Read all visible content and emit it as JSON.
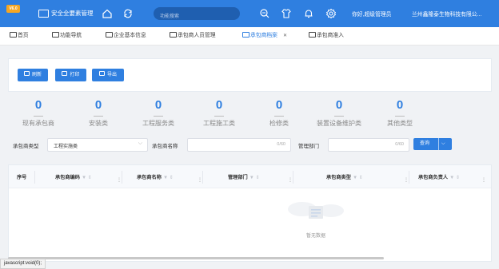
{
  "header": {
    "logo_text": "V6.0",
    "system_title": "安全全要素管理",
    "search_placeholder": "功能搜索",
    "greeting": "你好,超级管理员",
    "company": "兰州鑫隆泰生物科技有限公...",
    "icons": [
      "monitor-icon",
      "home-icon",
      "refresh-icon",
      "zoom-icon",
      "shirt-icon",
      "bell-icon",
      "gear-icon"
    ],
    "bar_color": "#2f7fe0"
  },
  "tabs": [
    {
      "label": "首页"
    },
    {
      "label": "功能导航"
    },
    {
      "label": "企业基本信息"
    },
    {
      "label": "承包商人员管理"
    },
    {
      "label": "承包商档案",
      "active": true
    },
    {
      "label": "承包商准入"
    }
  ],
  "toolbar": {
    "refresh_label": "刷新",
    "print_label": "打印",
    "export_label": "导出"
  },
  "stats": [
    {
      "value": "0",
      "label": "现有承包商"
    },
    {
      "value": "0",
      "label": "安装类"
    },
    {
      "value": "0",
      "label": "工程服务类"
    },
    {
      "value": "0",
      "label": "工程施工类"
    },
    {
      "value": "0",
      "label": "检修类"
    },
    {
      "value": "0",
      "label": "装置设备维护类"
    },
    {
      "value": "0",
      "label": "其他类型"
    }
  ],
  "filters": {
    "type_label": "承包商类型",
    "type_value": "工程实施类",
    "name_label": "承包商名称",
    "name_count": "0/60",
    "dept_label": "管理部门",
    "dept_count": "0/60",
    "query_label": "查询"
  },
  "table": {
    "columns": [
      "序号",
      "承包商编码",
      "承包商名称",
      "管理部门",
      "承包商类型",
      "承包商负责人"
    ],
    "empty_text": "暂无数据"
  },
  "status_bar": "javascript:void(0);"
}
